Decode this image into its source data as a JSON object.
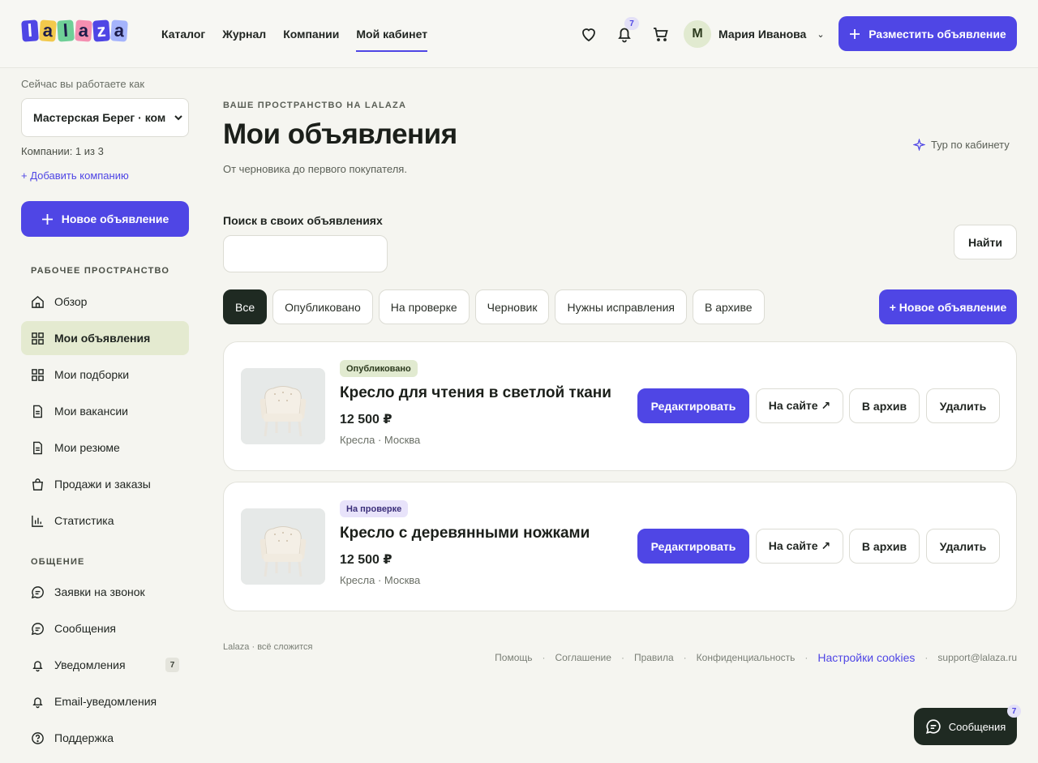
{
  "header": {
    "logo": [
      "l",
      "a",
      "l",
      "a",
      "z",
      "a"
    ],
    "logo_colors": [
      "#4f46e5",
      "#f2c94c",
      "#6fcf97",
      "#f48fb1",
      "#4f46e5",
      "#a5b4fc"
    ],
    "nav": [
      "Каталог",
      "Журнал",
      "Компании",
      "Мой кабинет"
    ],
    "active_nav": "Мой кабинет",
    "notifications_count": "7",
    "user_initial": "М",
    "user_name": "Мария Иванова",
    "post_button": "Разместить объявление",
    "icons": [
      "heart-icon",
      "bell-icon",
      "cart-icon",
      "chevron-down-icon",
      "plus-icon"
    ]
  },
  "sidebar": {
    "working_as": "Сейчас вы работаете как",
    "company": "Мастерская Берег · ком",
    "company_count": "Компании: 1 из 3",
    "add_company": "+ Добавить компанию",
    "new_ad": "Новое объявление",
    "workspace_title": "РАБОЧЕЕ ПРОСТРАНСТВО",
    "workspace_items": [
      {
        "label": "Обзор",
        "icon": "home-icon"
      },
      {
        "label": "Мои объявления",
        "icon": "grid-icon",
        "active": true
      },
      {
        "label": "Мои подборки",
        "icon": "grid-icon"
      },
      {
        "label": "Мои вакансии",
        "icon": "document-icon"
      },
      {
        "label": "Мои резюме",
        "icon": "document-icon"
      },
      {
        "label": "Продажи и заказы",
        "icon": "bag-icon"
      },
      {
        "label": "Статистика",
        "icon": "chart-icon"
      }
    ],
    "communication_title": "ОБЩЕНИЕ",
    "communication_items": [
      {
        "label": "Заявки на звонок",
        "icon": "chat-icon"
      },
      {
        "label": "Сообщения",
        "icon": "chat-icon"
      },
      {
        "label": "Уведомления",
        "icon": "bell-icon",
        "badge": "7"
      },
      {
        "label": "Email-уведомления",
        "icon": "bell-icon"
      },
      {
        "label": "Поддержка",
        "icon": "help-icon"
      }
    ]
  },
  "main": {
    "eyebrow": "ВАШЕ ПРОСТРАНСТВО НА LALAZA",
    "title": "Мои объявления",
    "subtitle": "От черновика до первого покупателя.",
    "tour": "Тур по кабинету",
    "search_label": "Поиск в своих объявлениях",
    "search_value": "",
    "find_button": "Найти",
    "filters": [
      "Все",
      "Опубликовано",
      "На проверке",
      "Черновик",
      "Нужны исправления",
      "В архиве"
    ],
    "active_filter": "Все",
    "new_ad_button": "+ Новое объявление",
    "listings": [
      {
        "status": "Опубликовано",
        "status_kind": "published",
        "title": "Кресло для чтения в светлой ткани",
        "price": "12 500 ₽",
        "meta": "Кресла · Москва"
      },
      {
        "status": "На проверке",
        "status_kind": "review",
        "title": "Кресло с деревянными ножками",
        "price": "12 500 ₽",
        "meta": "Кресла · Москва"
      }
    ],
    "card_actions": {
      "edit": "Редактировать",
      "on_site": "На сайте ↗",
      "archive": "В архив",
      "delete": "Удалить"
    }
  },
  "footer": {
    "brand": "Lalaza · всё сложится",
    "links": [
      "Помощь",
      "Соглашение",
      "Правила",
      "Конфиденциальность"
    ],
    "cookies": "Настройки cookies",
    "email": "support@lalaza.ru"
  },
  "chat": {
    "label": "Сообщения",
    "badge": "7"
  },
  "colors": {
    "accent": "#4f46e5",
    "dark": "#1f2a22",
    "active_bg": "#e4ead0"
  }
}
